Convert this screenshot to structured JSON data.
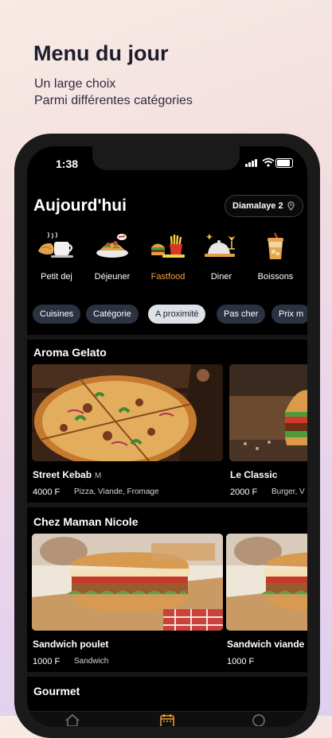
{
  "promo": {
    "title": "Menu du jour",
    "subtitle_line1": "Un large choix",
    "subtitle_line2": "Parmi différentes catégories"
  },
  "status_bar": {
    "time": "1:38"
  },
  "header": {
    "title": "Aujourd'hui",
    "location": "Diamalaye 2"
  },
  "categories": [
    {
      "label": "Petit dej",
      "icon": "breakfast-icon"
    },
    {
      "label": "Déjeuner",
      "icon": "lunch-icon"
    },
    {
      "label": "Fastfood",
      "icon": "fastfood-icon",
      "active": true
    },
    {
      "label": "Diner",
      "icon": "dinner-icon"
    },
    {
      "label": "Boissons",
      "icon": "drinks-icon"
    }
  ],
  "filters": [
    "Cuisines",
    "Catégorie",
    "A proximité",
    "Pas cher",
    "Prix m"
  ],
  "active_filter_index": 2,
  "sections": [
    {
      "title": "Aroma Gelato",
      "items": [
        {
          "name": "Street Kebab",
          "badge": "M",
          "price": "4000 F",
          "tags": "Pizza, Viande, Fromage",
          "image": "pizza"
        },
        {
          "name": "Le Classic",
          "price": "2000 F",
          "tags": "Burger, V",
          "image": "burger"
        }
      ]
    },
    {
      "title": "Chez Maman Nicole",
      "items": [
        {
          "name": "Sandwich poulet",
          "price": "1000 F",
          "tags": "Sandwich",
          "image": "sandwich"
        },
        {
          "name": "Sandwich viande",
          "price": "1000 F",
          "tags": "",
          "image": "sandwich"
        }
      ]
    },
    {
      "title": "Gourmet",
      "items": []
    }
  ],
  "tabbar": [
    {
      "icon": "home-icon"
    },
    {
      "icon": "calendar-icon",
      "active": true
    },
    {
      "icon": "search-icon"
    }
  ],
  "colors": {
    "accent": "#f2a03c",
    "chip_bg": "#2b3241",
    "chip_active_bg": "#dde1e8"
  }
}
